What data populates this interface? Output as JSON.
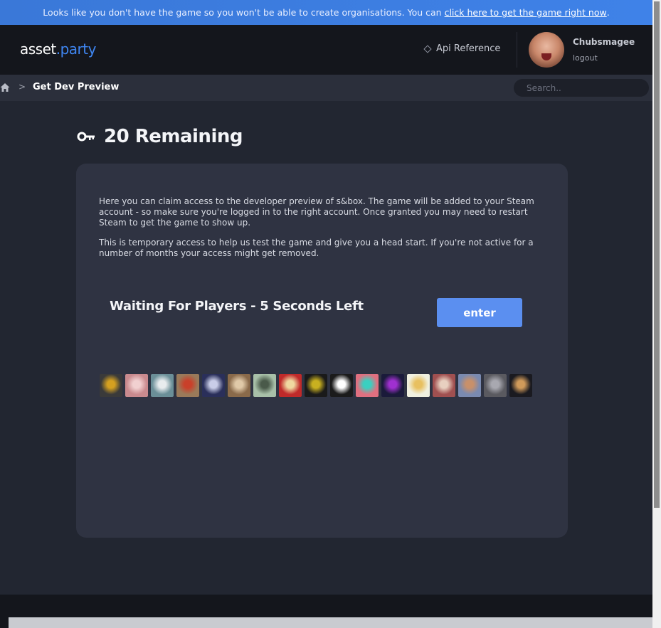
{
  "banner": {
    "text": "Looks like you don't have the game so you won't be able to create organisations. You can",
    "link": "click here to get the game right now",
    "end": "."
  },
  "header": {
    "logo_main": "asset",
    "logo_accent": ".party",
    "api_reference": "Api Reference",
    "username": "Chubsmagee",
    "logout": "logout"
  },
  "breadcrumb": {
    "separator": ">",
    "current": "Get Dev Preview"
  },
  "search": {
    "placeholder": "Search.."
  },
  "main": {
    "title": "20 Remaining",
    "paragraph1": "Here you can claim access to the developer preview of s&box. The game will be added to your Steam account - so make sure you're logged in to the right account. Once granted you may need to restart Steam to get the game to show up.",
    "paragraph2": "This is temporary access to help us test the game and give you a head start. If you're not active for a number of months your access might get removed.",
    "waiting": "Waiting For Players - 5 Seconds Left",
    "enter": "enter"
  },
  "players": [
    {
      "name": "player-avatar-1",
      "color": "#3a3a3a",
      "accent": "#d4a020"
    },
    {
      "name": "player-avatar-2",
      "color": "#c98a8e",
      "accent": "#f1d0d0"
    },
    {
      "name": "player-avatar-3",
      "color": "#6b8f98",
      "accent": "#e8ecee"
    },
    {
      "name": "player-avatar-4",
      "color": "#9a7a5a",
      "accent": "#c9402a"
    },
    {
      "name": "player-avatar-5",
      "color": "#2a2f5a",
      "accent": "#c9cde8"
    },
    {
      "name": "player-avatar-6",
      "color": "#8a6a4a",
      "accent": "#e0c9a8"
    },
    {
      "name": "player-avatar-7",
      "color": "#a8c0a8",
      "accent": "#4a5a4a"
    },
    {
      "name": "player-avatar-8",
      "color": "#c02a2a",
      "accent": "#f0d8a0"
    },
    {
      "name": "player-avatar-9",
      "color": "#1a1a1a",
      "accent": "#c8b020"
    },
    {
      "name": "player-avatar-10",
      "color": "#1b1b1b",
      "accent": "#ffffff"
    },
    {
      "name": "player-avatar-11",
      "color": "#e07080",
      "accent": "#3ad0c0"
    },
    {
      "name": "player-avatar-12",
      "color": "#1a1a3a",
      "accent": "#a030d0"
    },
    {
      "name": "player-avatar-13",
      "color": "#f0f0e0",
      "accent": "#e8c060"
    },
    {
      "name": "player-avatar-14",
      "color": "#a05050",
      "accent": "#e8d0c0"
    },
    {
      "name": "player-avatar-15",
      "color": "#7a8ab0",
      "accent": "#c8906a"
    },
    {
      "name": "player-avatar-16",
      "color": "#5a5a60",
      "accent": "#a8a8b0"
    },
    {
      "name": "player-avatar-17",
      "color": "#1a1a20",
      "accent": "#d09a5a"
    }
  ],
  "colors": {
    "banner": "#3f82e8",
    "accent": "#3f86f2",
    "button": "#5b8ff0",
    "card": "#2f3342"
  }
}
